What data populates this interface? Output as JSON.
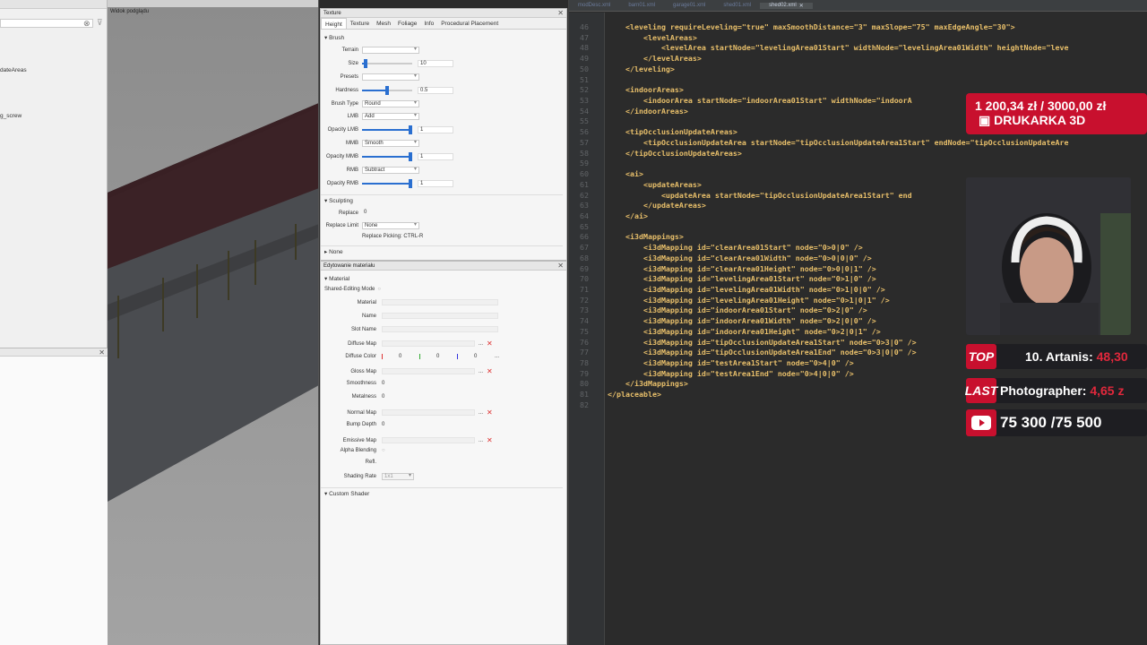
{
  "left_panel": {
    "items": [
      "dateAreas",
      "g_screw"
    ]
  },
  "viewport": {
    "title": "Widok podglądu"
  },
  "texture_panel": {
    "title": "Texture",
    "tabs": [
      "Height",
      "Texture",
      "Mesh",
      "Foliage",
      "Info",
      "Procedural Placement"
    ],
    "brush_section": "Brush",
    "terrain_label": "Terrain",
    "size_label": "Size",
    "size_value": "10",
    "presets_label": "Presets",
    "hardness_label": "Hardness",
    "hardness_value": "0.5",
    "brush_type_label": "Brush Type",
    "brush_type_value": "Round",
    "lmb_label": "LMB",
    "lmb_value": "Add",
    "opacity_lmb_label": "Opacity LMB",
    "opacity_lmb_value": "1",
    "mmb_label": "MMB",
    "mmb_value": "Smooth",
    "opacity_mmb_label": "Opacity MMB",
    "opacity_mmb_value": "1",
    "rmb_label": "RMB",
    "rmb_value": "Subtract",
    "opacity_rmb_label": "Opacity RMB",
    "opacity_rmb_value": "1",
    "sculpting_section": "Sculpting",
    "replace_label": "Replace",
    "replace_value": "0",
    "replace_limit_label": "Replace Limit",
    "replace_limit_value": "None",
    "replace_picking": "Replace Picking: CTRL-R",
    "none_section": "None"
  },
  "material_panel": {
    "title": "Edytowanie materiału",
    "section": "Material",
    "shared_editing": "Shared-Editing Mode",
    "fields": {
      "material": "Material",
      "name": "Name",
      "slot_name": "Slot Name",
      "diffuse_map": "Diffuse Map",
      "diffuse_color": "Diffuse Color",
      "diffuse_r": "0",
      "diffuse_g": "0",
      "diffuse_b": "0",
      "gloss_map": "Gloss Map",
      "smoothness": "Smoothness",
      "smoothness_value": "0",
      "metalness": "Metalness",
      "metalness_value": "0",
      "normal_map": "Normal Map",
      "bump_depth": "Bump Depth",
      "bump_depth_value": "0",
      "emissive_map": "Emissive Map",
      "alpha_blending": "Alpha Blending",
      "refl": "Refl.",
      "shading_rate": "Shading Rate",
      "shading_rate_value": "1x1"
    },
    "custom_shader": "Custom Shader"
  },
  "editor": {
    "tabs": [
      "modDesc.xml",
      "barn01.xml",
      "garage01.xml",
      "shed01.xml",
      "shed02.xml"
    ],
    "lines": [
      {
        "n": "46",
        "t": "    <leveling requireLeveling=\"true\" maxSmoothDistance=\"3\" maxSlope=\"75\" maxEdgeAngle=\"30\">"
      },
      {
        "n": "47",
        "t": "        <levelAreas>"
      },
      {
        "n": "48",
        "t": "            <levelArea startNode=\"levelingArea01Start\" widthNode=\"levelingArea01Width\" heightNode=\"leve"
      },
      {
        "n": "49",
        "t": "        </levelAreas>"
      },
      {
        "n": "50",
        "t": "    </leveling>"
      },
      {
        "n": "51",
        "t": ""
      },
      {
        "n": "52",
        "t": "    <indoorAreas>"
      },
      {
        "n": "53",
        "t": "        <indoorArea startNode=\"indoorArea01Start\" widthNode=\"indoorA"
      },
      {
        "n": "54",
        "t": "    </indoorAreas>"
      },
      {
        "n": "55",
        "t": ""
      },
      {
        "n": "56",
        "t": "    <tipOcclusionUpdateAreas>"
      },
      {
        "n": "57",
        "t": "        <tipOcclusionUpdateArea startNode=\"tipOcclusionUpdateArea1Start\" endNode=\"tipOcclusionUpdateAre"
      },
      {
        "n": "58",
        "t": "    </tipOcclusionUpdateAreas>"
      },
      {
        "n": "59",
        "t": ""
      },
      {
        "n": "60",
        "t": "    <ai>"
      },
      {
        "n": "61",
        "t": "        <updateAreas>"
      },
      {
        "n": "62",
        "t": "            <updateArea startNode=\"tipOcclusionUpdateArea1Start\" end"
      },
      {
        "n": "63",
        "t": "        </updateAreas>"
      },
      {
        "n": "64",
        "t": "    </ai>"
      },
      {
        "n": "65",
        "t": ""
      },
      {
        "n": "66",
        "t": "    <i3dMappings>"
      },
      {
        "n": "67",
        "t": "        <i3dMapping id=\"clearArea01Start\" node=\"0>0|0\" />"
      },
      {
        "n": "68",
        "t": "        <i3dMapping id=\"clearArea01Width\" node=\"0>0|0|0\" />"
      },
      {
        "n": "69",
        "t": "        <i3dMapping id=\"clearArea01Height\" node=\"0>0|0|1\" />"
      },
      {
        "n": "70",
        "t": "        <i3dMapping id=\"levelingArea01Start\" node=\"0>1|0\" />"
      },
      {
        "n": "71",
        "t": "        <i3dMapping id=\"levelingArea01Width\" node=\"0>1|0|0\" />"
      },
      {
        "n": "72",
        "t": "        <i3dMapping id=\"levelingArea01Height\" node=\"0>1|0|1\" />"
      },
      {
        "n": "73",
        "t": "        <i3dMapping id=\"indoorArea01Start\" node=\"0>2|0\" />"
      },
      {
        "n": "74",
        "t": "        <i3dMapping id=\"indoorArea01Width\" node=\"0>2|0|0\" />"
      },
      {
        "n": "75",
        "t": "        <i3dMapping id=\"indoorArea01Height\" node=\"0>2|0|1\" />"
      },
      {
        "n": "76",
        "t": "        <i3dMapping id=\"tipOcclusionUpdateArea1Start\" node=\"0>3|0\" />"
      },
      {
        "n": "77",
        "t": "        <i3dMapping id=\"tipOcclusionUpdateArea1End\" node=\"0>3|0|0\" />"
      },
      {
        "n": "78",
        "t": "        <i3dMapping id=\"testArea1Start\" node=\"0>4|0\" />"
      },
      {
        "n": "79",
        "t": "        <i3dMapping id=\"testArea1End\" node=\"0>4|0|0\" />"
      },
      {
        "n": "80",
        "t": "    </i3dMappings>"
      },
      {
        "n": "81",
        "t": "</placeable>"
      },
      {
        "n": "82",
        "t": ""
      }
    ]
  },
  "overlay": {
    "donation_amount": "1 200,34 zł / 3000,00 zł",
    "donation_label": "DRUKARKA 3D",
    "top_label": "TOP",
    "top_text": "10. Artanis:",
    "top_amount": "48,30",
    "last_label": "LAST",
    "last_text": "Photographer:",
    "last_amount": "4,65 z",
    "youtube_text": "75 300 /75 500"
  },
  "colors": {
    "accent": "#2a6fd0",
    "overlay_red": "#c8102e"
  }
}
